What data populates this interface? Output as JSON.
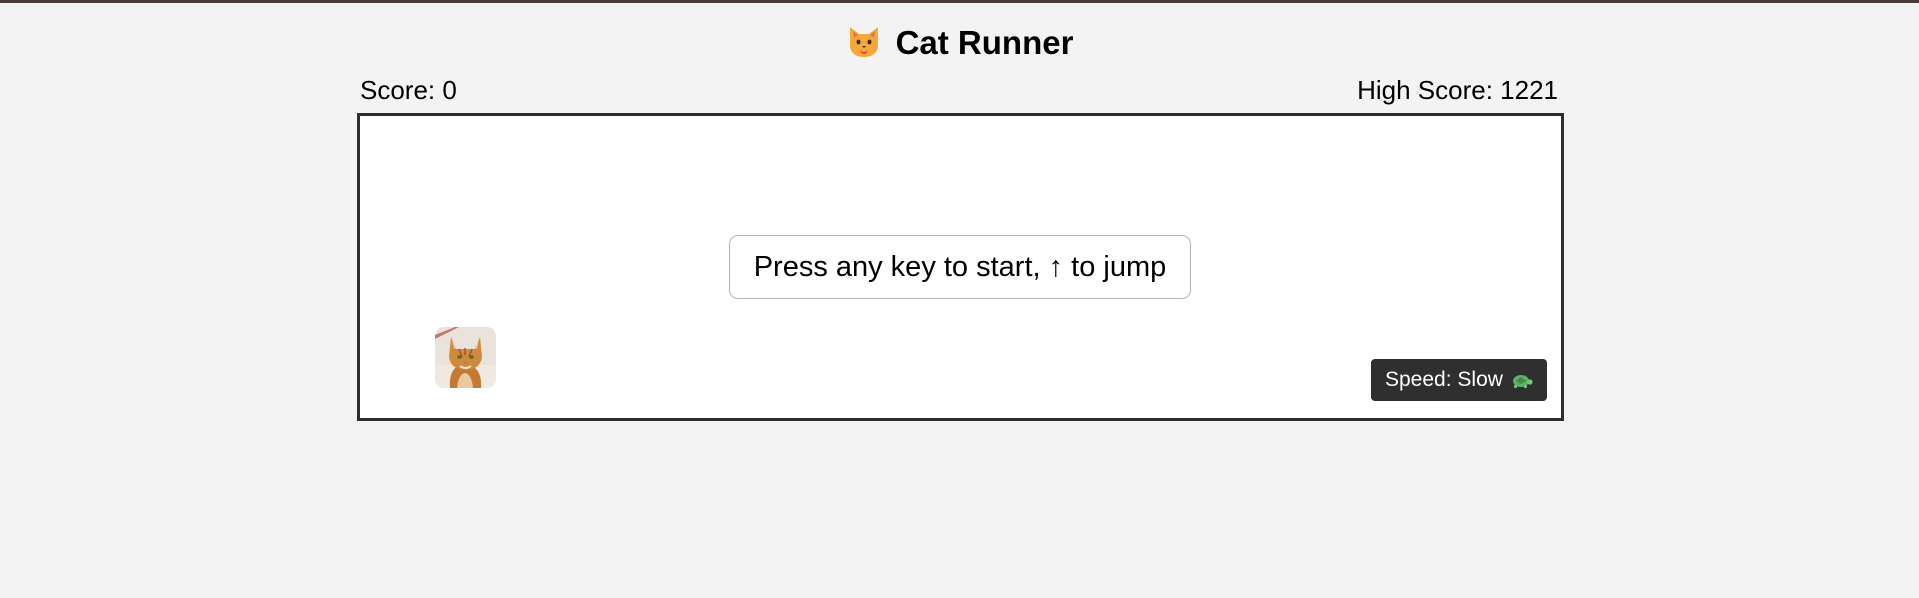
{
  "header": {
    "title": "Cat Runner",
    "title_icon": "cat-face-icon"
  },
  "scoreboard": {
    "score_label": "Score: 0",
    "score_value": 0,
    "high_score_label": "High Score: 1221",
    "high_score_value": 1221
  },
  "game": {
    "start_message": "Press any key to start, ↑ to jump",
    "player": "cat-sprite",
    "speed_label": "Speed: Slow",
    "speed_icon": "turtle-icon"
  },
  "colors": {
    "background": "#f3f3f3",
    "canvas": "#ffffff",
    "border": "#2d2d2d",
    "speed_badge": "#2f2f2f"
  }
}
